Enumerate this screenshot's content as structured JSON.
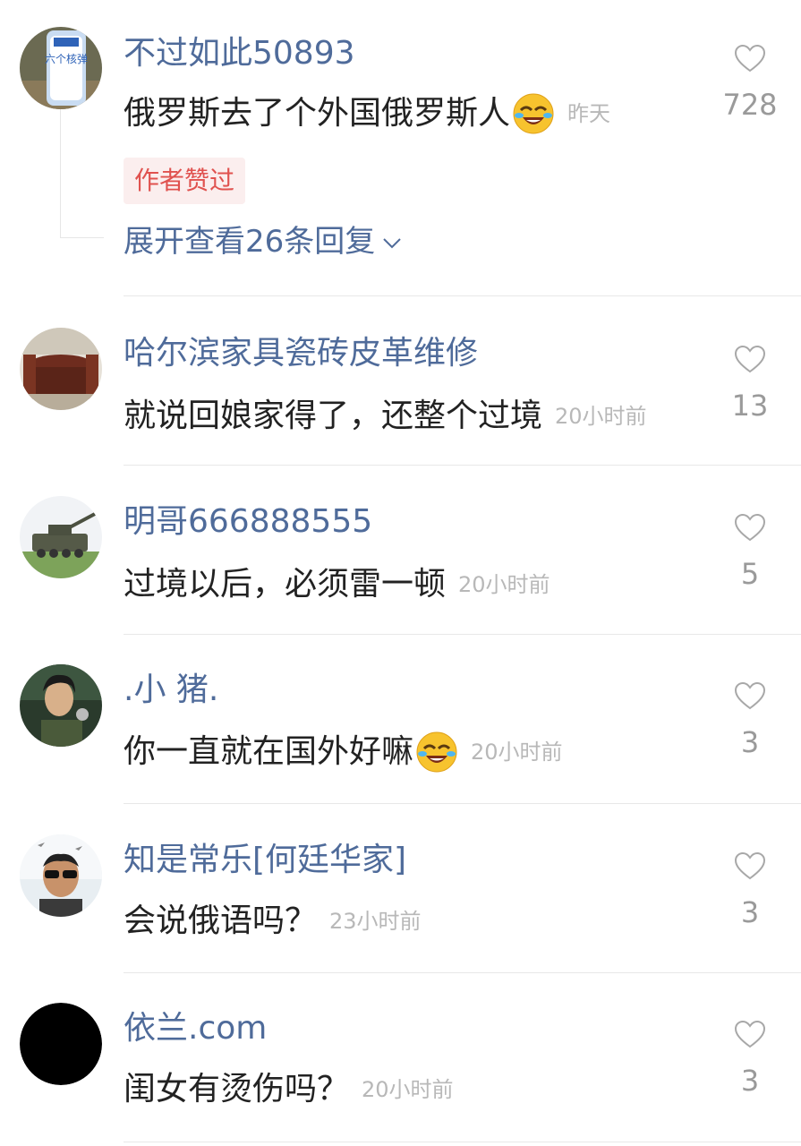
{
  "comments": [
    {
      "username": "不过如此50893",
      "text": "俄罗斯去了个外国俄罗斯人",
      "emoji": "laughing-tears-emoji",
      "time": "昨天",
      "likes": "728",
      "badge": "作者赞过",
      "expand": "展开查看26条回复",
      "avatar_label": "六个核弹"
    },
    {
      "username": "哈尔滨家具瓷砖皮革维修",
      "text": "就说回娘家得了，还整个过境",
      "time": "20小时前",
      "likes": "13"
    },
    {
      "username": "明哥666888555",
      "text": "过境以后，必须雷一顿",
      "time": "20小时前",
      "likes": "5"
    },
    {
      "username": ".小 猪.",
      "text": "你一直就在国外好嘛",
      "emoji": "laughing-tears-emoji",
      "time": "20小时前",
      "likes": "3"
    },
    {
      "username": "知是常乐[何廷华家]",
      "text": "会说俄语吗？",
      "time": "23小时前",
      "likes": "3"
    },
    {
      "username": "依兰.com",
      "text": "闺女有烫伤吗？",
      "time": "20小时前",
      "likes": "3"
    }
  ],
  "icons": {
    "like": "heart-outline-icon",
    "expand": "chevron-down-icon"
  },
  "colors": {
    "username": "#4f6b9a",
    "badge_text": "#e0524f",
    "badge_bg": "#fbeeee",
    "timestamp": "#b8b8b8"
  }
}
